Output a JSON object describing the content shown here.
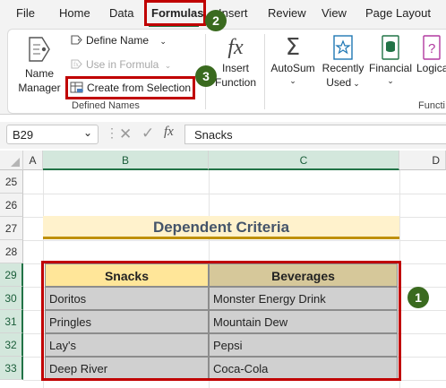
{
  "menu": {
    "items": [
      "File",
      "Home",
      "Data",
      "Formulas",
      "Insert",
      "Review",
      "View",
      "Page Layout"
    ],
    "active": "Formulas"
  },
  "ribbon": {
    "name_manager": [
      "Name",
      "Manager"
    ],
    "define_name": "Define Name",
    "use_in_formula": "Use in Formula",
    "create_from_selection": "Create from Selection",
    "defined_names_label": "Defined Names",
    "insert_function": [
      "Insert",
      "Function"
    ],
    "autosum": "AutoSum",
    "recently_used": [
      "Recently",
      "Used"
    ],
    "financial": "Financial",
    "logical": "Logica",
    "function_library_label": "Functi"
  },
  "formula_bar": {
    "name_box": "B29",
    "value": "Snacks"
  },
  "grid": {
    "columns": [
      "A",
      "B",
      "C",
      "D"
    ],
    "rows": [
      "25",
      "26",
      "27",
      "28",
      "29",
      "30",
      "31",
      "32",
      "33"
    ],
    "title": "Dependent Criteria",
    "table": {
      "headers": [
        "Snacks",
        "Beverages"
      ],
      "rows": [
        [
          "Doritos",
          "Monster Energy Drink"
        ],
        [
          "Pringles",
          "Mountain Dew"
        ],
        [
          "Lay's",
          "Pepsi"
        ],
        [
          "Deep River",
          "Coca-Cola"
        ]
      ]
    }
  },
  "badges": [
    "1",
    "2",
    "3"
  ],
  "colors": {
    "accent": "#217346",
    "highlight_box": "#c00000",
    "badge": "#3a6a1f",
    "title_fill": "#fff2cc",
    "header_snacks": "#ffe699",
    "header_beverages": "#d6c89a",
    "body_fill": "#d0d0d0"
  }
}
